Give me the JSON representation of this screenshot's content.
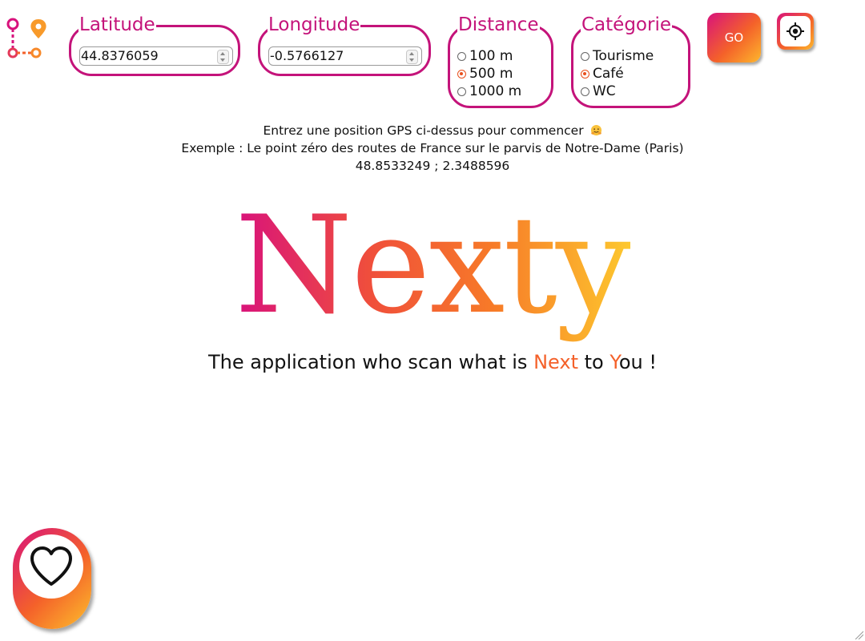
{
  "app": {
    "logo_icon": "route-pins-icon",
    "brand_name": "Nexty",
    "tagline": {
      "before": "The application who scan what is ",
      "next": "Next",
      "middle": " to ",
      "you_first_letter": "Y",
      "you_rest": "ou !"
    }
  },
  "form": {
    "latitude": {
      "legend": "Latitude",
      "value": "44.8376059"
    },
    "longitude": {
      "legend": "Longitude",
      "value": "-0.5766127"
    },
    "distance": {
      "legend": "Distance",
      "options": [
        "100 m",
        "500 m",
        "1000 m"
      ],
      "selected": "500 m"
    },
    "category": {
      "legend": "Catégorie",
      "options": [
        "Tourisme",
        "Café",
        "WC"
      ],
      "selected": "Café"
    },
    "go_label": "GO",
    "locate_icon": "crosshair-icon"
  },
  "info": {
    "line1": "Entrez une position GPS ci-dessus pour commencer",
    "line1_emoji": "hugging-face-icon",
    "line2": "Exemple : Le point zéro des routes de France sur le parvis de Notre-Dame (Paris)",
    "line3": "48.8533249 ; 2.3488596"
  },
  "favorites": {
    "icon": "heart-icon"
  },
  "colors": {
    "accent_magenta": "#c4137a",
    "accent_orange": "#f4612a",
    "accent_yellow": "#fdc02c",
    "radio_checked": "#e8501e"
  }
}
